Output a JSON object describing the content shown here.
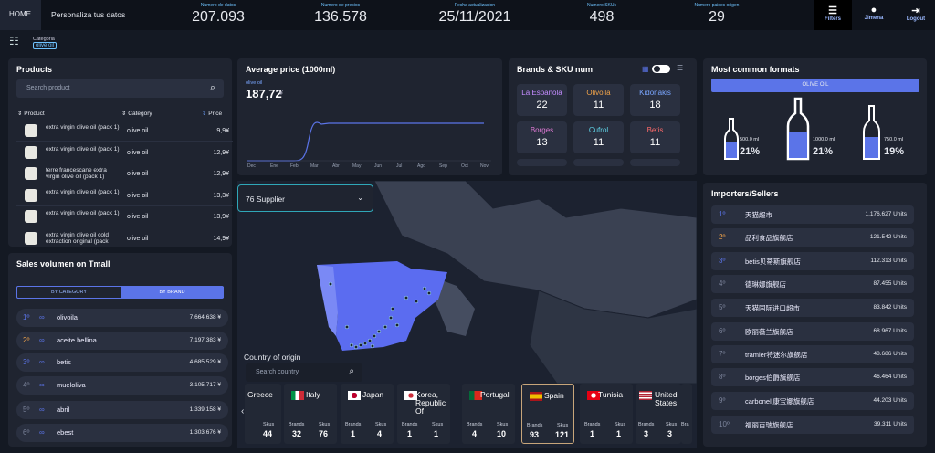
{
  "header": {
    "home": "HOME",
    "personaliza": "Personaliza tus datos",
    "kpis": [
      {
        "label": "Numero de datos",
        "value": "207.093"
      },
      {
        "label": "Numero de precios",
        "value": "136.578"
      },
      {
        "label": "Fecha actualizacion",
        "value": "25/11/2021"
      },
      {
        "label": "Numero SKUs",
        "value": "498"
      },
      {
        "label": "Numero paises origen",
        "value": "29"
      }
    ],
    "filters": "Filters",
    "user": "Jimena",
    "logout": "Logout"
  },
  "filterbar": {
    "category_label": "Categoria",
    "category_value": "olive oil"
  },
  "products": {
    "title": "Products",
    "search_placeholder": "Search product",
    "col_product": "Product",
    "col_category": "Category",
    "col_price": "Price",
    "rows": [
      {
        "name": "extra virgin olive oil (pack 1)",
        "category": "olive oil",
        "price": "9,9¥"
      },
      {
        "name": "extra virgin olive oil (pack 1)",
        "category": "olive oil",
        "price": "12,9¥"
      },
      {
        "name": "terre francescane extra virgin olive oil (pack 1)",
        "category": "olive oil",
        "price": "12,9¥"
      },
      {
        "name": "extra virgin olive oil (pack 1)",
        "category": "olive oil",
        "price": "13,3¥"
      },
      {
        "name": "extra virgin olive oil (pack 1)",
        "category": "olive oil",
        "price": "13,9¥"
      },
      {
        "name": "extra virgin olive oil cold extraction original (pack",
        "category": "olive oil",
        "price": "14,9¥"
      }
    ]
  },
  "avgprice": {
    "title": "Average price (1000ml)",
    "series": "olive oil",
    "value": "187,72",
    "unit": "¥",
    "months": [
      "Dec",
      "Ene",
      "Feb",
      "Mar",
      "Abr",
      "May",
      "Jun",
      "Jul",
      "Ago",
      "Sep",
      "Oct",
      "Nov"
    ]
  },
  "brands": {
    "title": "Brands & SKU num",
    "items": [
      {
        "name": "La Española",
        "count": "22",
        "color": "#c48cff"
      },
      {
        "name": "Olivoila",
        "count": "11",
        "color": "#f0a34a"
      },
      {
        "name": "Kidonakis",
        "count": "18",
        "color": "#7aa6ff"
      },
      {
        "name": "Borges",
        "count": "13",
        "color": "#e07ad6"
      },
      {
        "name": "Cufrol",
        "count": "11",
        "color": "#5fd4e8"
      },
      {
        "name": "Betis",
        "count": "11",
        "color": "#ff6a6a"
      }
    ]
  },
  "formats": {
    "title": "Most common formats",
    "tab": "OLIVE OIL",
    "items": [
      {
        "ml": "500.0 ml",
        "pct": "21%",
        "fill": 0.55
      },
      {
        "ml": "1000.0 ml",
        "pct": "21%",
        "fill": 0.6
      },
      {
        "ml": "750.0 ml",
        "pct": "19%",
        "fill": 0.55
      }
    ]
  },
  "map": {
    "supplier": "76 Supplier",
    "country_of_origin": "Country of origin",
    "search_placeholder": "Search country"
  },
  "countries": [
    {
      "name": "Greece",
      "brands": "",
      "skus": "44",
      "brands_label": "",
      "skus_label": "Skus"
    },
    {
      "name": "Italy",
      "brands": "32",
      "skus": "76",
      "brands_label": "Brands",
      "skus_label": "Skus"
    },
    {
      "name": "Japan",
      "brands": "1",
      "skus": "4",
      "brands_label": "Brands",
      "skus_label": "Skus"
    },
    {
      "name": "Korea, Republic Of",
      "brands": "1",
      "skus": "1",
      "brands_label": "Brands",
      "skus_label": "Skus"
    },
    {
      "name": "Portugal",
      "brands": "4",
      "skus": "10",
      "brands_label": "Brands",
      "skus_label": "Skus"
    },
    {
      "name": "Spain",
      "brands": "93",
      "skus": "121",
      "brands_label": "Brands",
      "skus_label": "Skus"
    },
    {
      "name": "Tunisia",
      "brands": "1",
      "skus": "1",
      "brands_label": "Brands",
      "skus_label": "Skus"
    },
    {
      "name": "United States",
      "brands": "3",
      "skus": "3",
      "brands_label": "Brands",
      "skus_label": "Skus"
    },
    {
      "name": "",
      "brands": "",
      "skus": "",
      "brands_label": "Bra",
      "skus_label": ""
    }
  ],
  "sales": {
    "title": "Sales volumen on Tmall",
    "tab1": "BY CATEGORY",
    "tab2": "BY BRAND",
    "rows": [
      {
        "rank": "1º",
        "name": "olivoila",
        "value": "7.664.638 ¥"
      },
      {
        "rank": "2º",
        "name": "aceite bellina",
        "value": "7.197.383 ¥"
      },
      {
        "rank": "3º",
        "name": "betis",
        "value": "4.685.529 ¥"
      },
      {
        "rank": "4º",
        "name": "mueloliva",
        "value": "3.105.717 ¥"
      },
      {
        "rank": "5º",
        "name": "abril",
        "value": "1.339.158 ¥"
      },
      {
        "rank": "6º",
        "name": "ebest",
        "value": "1.303.676 ¥"
      }
    ]
  },
  "importers": {
    "title": "Importers/Sellers",
    "rows": [
      {
        "rank": "1º",
        "name": "天猫超市",
        "value": "1.176.627 Units"
      },
      {
        "rank": "2º",
        "name": "品利食品旗舰店",
        "value": "121.542 Units"
      },
      {
        "rank": "3º",
        "name": "betis贝蒂斯旗舰店",
        "value": "112.313 Units"
      },
      {
        "rank": "4º",
        "name": "德琳娜旗舰店",
        "value": "87.455 Units"
      },
      {
        "rank": "5º",
        "name": "天猫国际进口超市",
        "value": "83.842 Units"
      },
      {
        "rank": "6º",
        "name": "欧丽薇兰旗舰店",
        "value": "68.967 Units"
      },
      {
        "rank": "7º",
        "name": "tramier特迷尔旗舰店",
        "value": "48.686 Units"
      },
      {
        "rank": "8º",
        "name": "borges伯爵旗舰店",
        "value": "46.464 Units"
      },
      {
        "rank": "9º",
        "name": "carbonell康宝娜旗舰店",
        "value": "44.203 Units"
      },
      {
        "rank": "10º",
        "name": "福丽百瑞旗舰店",
        "value": "39.311 Units"
      }
    ]
  }
}
